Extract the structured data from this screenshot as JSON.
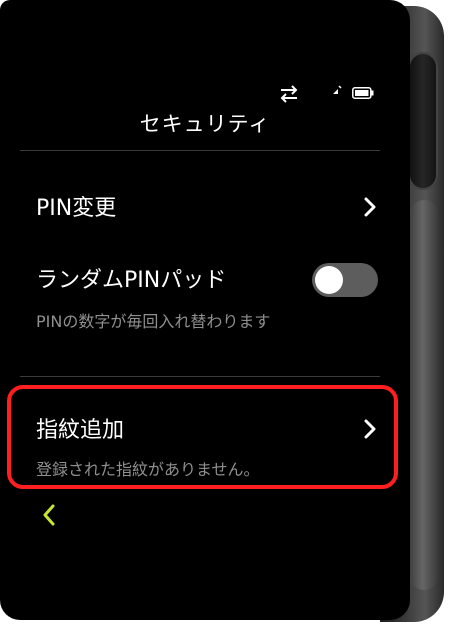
{
  "header": {
    "title": "セキュリティ"
  },
  "status_bar": {
    "icons": [
      "sync-arrows-icon",
      "signal-icon",
      "battery-icon"
    ]
  },
  "settings": [
    {
      "label": "PIN変更",
      "control": "chevron-right"
    },
    {
      "label": "ランダムPINパッド",
      "subtitle": "PINの数字が毎回入れ替わります",
      "control": "toggle",
      "toggle_on": false
    },
    {
      "label": "指紋追加",
      "subtitle": "登録された指紋がありません。",
      "control": "chevron-right",
      "highlighted": true
    }
  ],
  "navigation": {
    "back_icon": "chevron-left-icon"
  },
  "colors": {
    "screen_background": "#000000",
    "text_primary": "#ffffff",
    "text_secondary": "#8f8f8f",
    "divider": "#3a3a3a",
    "toggle_off": "#5d5d5d",
    "back_arrow": "#c6e635",
    "highlight_border": "#ff1f1f"
  }
}
